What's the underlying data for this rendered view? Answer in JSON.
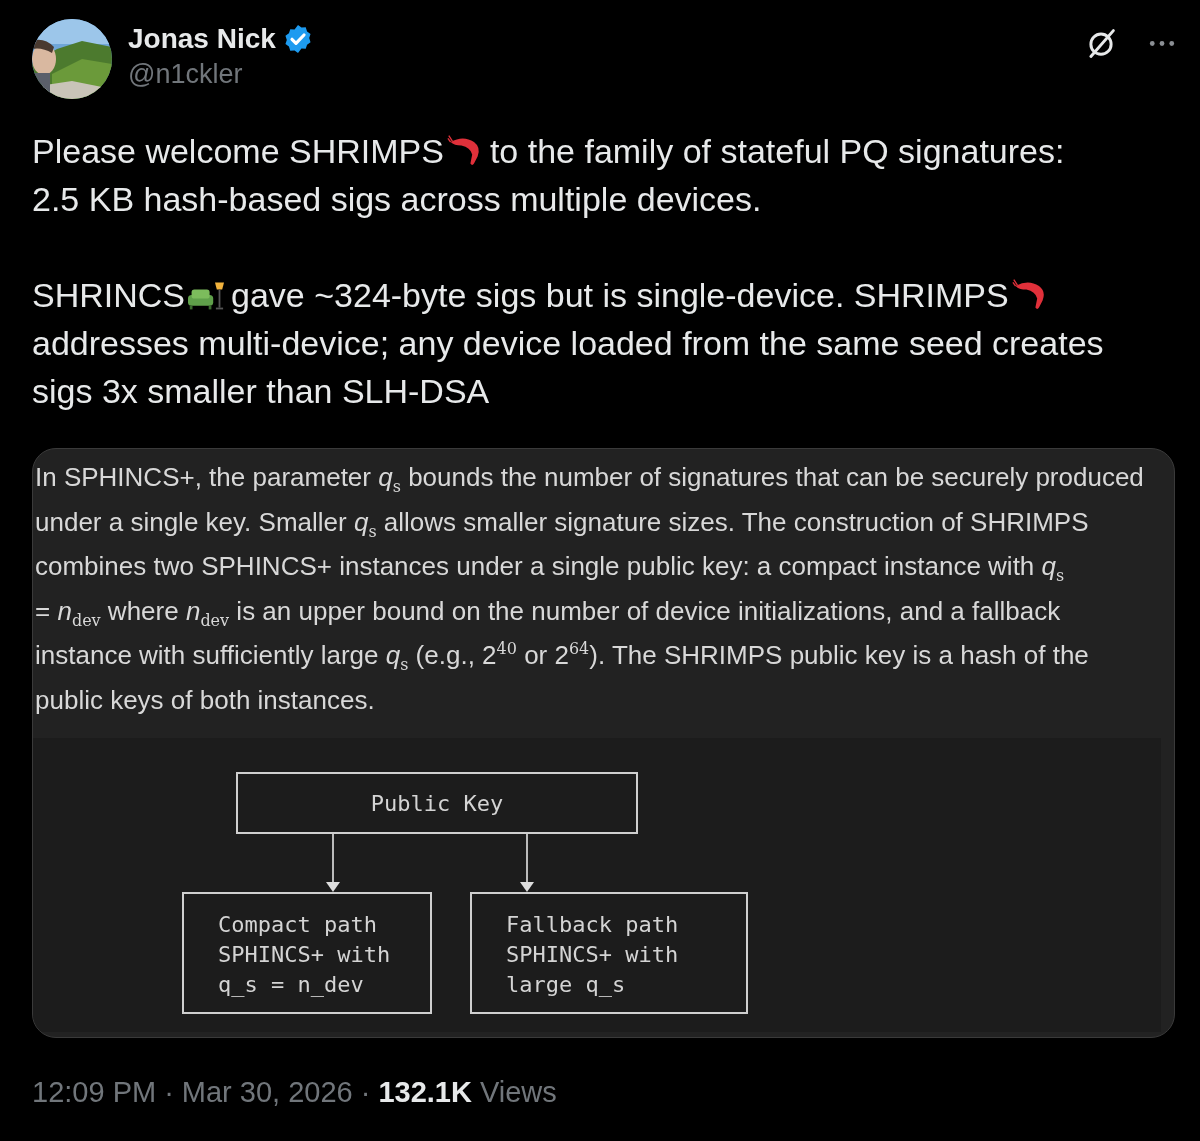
{
  "author": {
    "name": "Jonas Nick",
    "verified": true,
    "handle": "@n1ckler"
  },
  "paragraphs": [
    [
      {
        "kind": "text",
        "text": "Please welcome SHRIMPS"
      },
      {
        "kind": "shrimp"
      },
      {
        "kind": "text",
        "text": "to the family of stateful PQ signatures:"
      },
      {
        "kind": "break"
      },
      {
        "kind": "text",
        "text": "2.5 KB hash-based sigs across multiple devices."
      }
    ],
    [
      {
        "kind": "text",
        "text": "SHRINCS"
      },
      {
        "kind": "couch"
      },
      {
        "kind": "text",
        "text": "gave ~324-byte sigs but is single-device. SHRIMPS"
      },
      {
        "kind": "shrimp"
      },
      {
        "kind": "break"
      },
      {
        "kind": "text",
        "text": "addresses multi-device; any device loaded from the same seed creates"
      },
      {
        "kind": "break"
      },
      {
        "kind": "text",
        "text": "sigs 3x smaller than SLH-DSA"
      }
    ]
  ],
  "image": {
    "lines": [
      "In SPHINCS+, the parameter *q*$_{s}$ bounds the number of signatures that can be securely produced",
      "under a single key. Smaller *q*$_{s}$ allows smaller signature sizes. The construction of SHRIMPS",
      "combines two SPHINCS+ instances under a single public key: a compact instance with *q*$_{s}$",
      "= *n*$_{dev}$ where *n*$_{dev}$ is an upper bound on the number of device initializations, and a fallback",
      "instance with sufficiently large *q*$_{s}$ (e.g., 2$^{40}$ or 2$^{64}$). The SHRIMPS public key is a hash of the",
      "public keys of both instances."
    ],
    "diagram": {
      "root": "Public Key",
      "children": [
        [
          "Compact path",
          "SPHINCS+ with",
          "q_s = n_dev"
        ],
        [
          "Fallback path",
          "SPHINCS+ with",
          "large q_s"
        ]
      ]
    }
  },
  "footer": {
    "separator": "·",
    "time": "12:09 PM",
    "date": "Mar 30, 2026",
    "views_count": "132.1K",
    "views_label": "Views"
  }
}
